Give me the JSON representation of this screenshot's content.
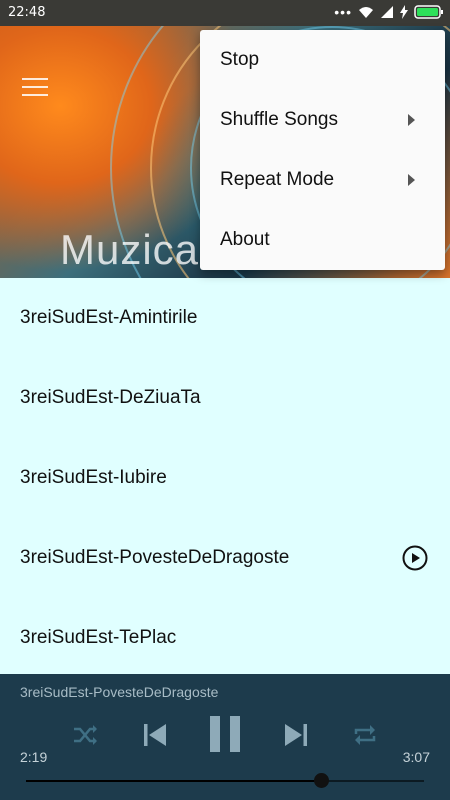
{
  "status_bar": {
    "time": "22:48"
  },
  "hero": {
    "title": "Muzica"
  },
  "overflow_menu": {
    "items": [
      {
        "label": "Stop",
        "has_submenu": false
      },
      {
        "label": "Shuffle Songs",
        "has_submenu": true
      },
      {
        "label": "Repeat Mode",
        "has_submenu": true
      },
      {
        "label": "About",
        "has_submenu": false
      }
    ]
  },
  "songs": [
    {
      "title": "3reiSudEst-Amintirile",
      "playing": false
    },
    {
      "title": "3reiSudEst-DeZiuaTa",
      "playing": false
    },
    {
      "title": "3reiSudEst-Iubire",
      "playing": false
    },
    {
      "title": "3reiSudEst-PovesteDeDragoste",
      "playing": true
    },
    {
      "title": "3reiSudEst-TePlac",
      "playing": false
    }
  ],
  "player": {
    "now_playing": "3reiSudEst-PovesteDeDragoste",
    "elapsed": "2:19",
    "duration": "3:07",
    "progress": 0.74,
    "colors": {
      "background": "#1d3b4c",
      "list_background": "#e0ffff"
    }
  }
}
